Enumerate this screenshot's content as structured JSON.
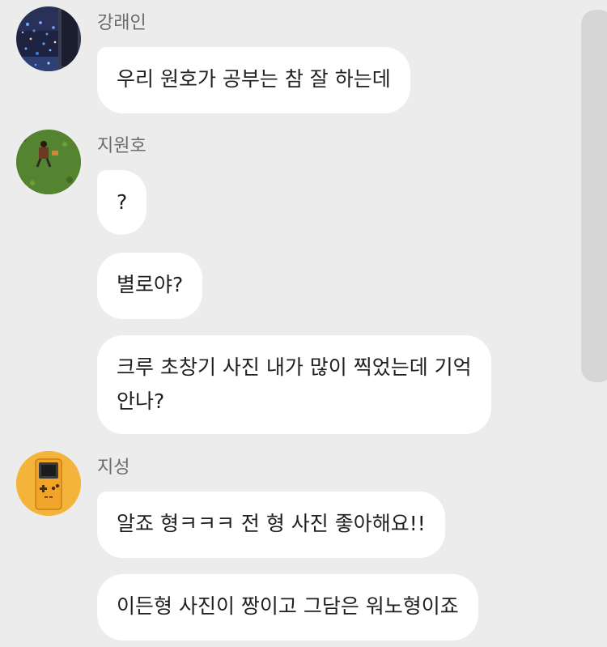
{
  "messages": [
    {
      "sender": "강래인",
      "bubbles": [
        "우리 원호가 공부는 참 잘 하는데"
      ]
    },
    {
      "sender": "지원호",
      "bubbles": [
        "?",
        "별로야?",
        [
          "크루 초창기 사진 내가 많이 찍었는데 기억",
          "안나?"
        ]
      ]
    },
    {
      "sender": "지성",
      "bubbles": [
        "알죠 형ㅋㅋㅋ 전 형 사진 좋아해요!!",
        "이든형 사진이 짱이고 그담은 워노형이죠"
      ]
    }
  ],
  "colors": {
    "background": "#ececec",
    "bubble": "#ffffff",
    "sender_text": "#6b6b6b",
    "message_text": "#1f1f1f",
    "scrollbar": "#d6d6d6",
    "avatar3_bg": "#f4b43c"
  },
  "icons": {
    "avatar1": "night-city-photo",
    "avatar2": "person-on-grass-photo",
    "avatar3": "handheld-game-console-icon"
  }
}
